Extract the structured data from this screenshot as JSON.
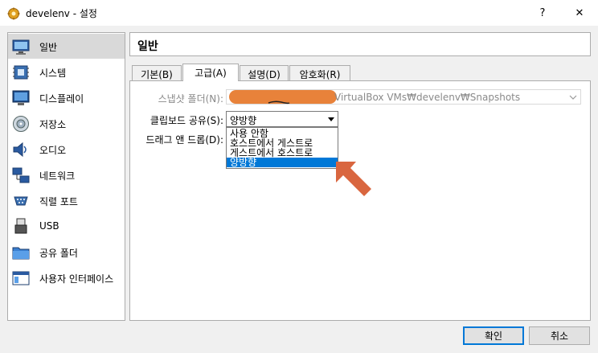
{
  "window": {
    "title": "develenv - 설정",
    "help_glyph": "?",
    "close_glyph": "✕"
  },
  "sidebar": {
    "items": [
      {
        "label": "일반",
        "icon": "general-monitor-icon"
      },
      {
        "label": "시스템",
        "icon": "system-chip-icon"
      },
      {
        "label": "디스플레이",
        "icon": "display-monitor-icon"
      },
      {
        "label": "저장소",
        "icon": "storage-disk-icon"
      },
      {
        "label": "오디오",
        "icon": "audio-speaker-icon"
      },
      {
        "label": "네트워크",
        "icon": "network-icon"
      },
      {
        "label": "직렬 포트",
        "icon": "serial-port-icon"
      },
      {
        "label": "USB",
        "icon": "usb-icon"
      },
      {
        "label": "공유 폴더",
        "icon": "shared-folder-icon"
      },
      {
        "label": "사용자 인터페이스",
        "icon": "user-interface-icon"
      }
    ]
  },
  "page": {
    "title": "일반"
  },
  "tabs": [
    {
      "label": "기본(B)"
    },
    {
      "label": "고급(A)"
    },
    {
      "label": "설명(D)"
    },
    {
      "label": "암호화(R)"
    }
  ],
  "advanced": {
    "snapshot_label": "스냅샷 폴더(N):",
    "snapshot_path_visible": "VirtualBox VMs₩develenv₩Snapshots",
    "clipboard_label": "클립보드 공유(S):",
    "clipboard_value": "양방향",
    "clipboard_options": [
      "사용 안함",
      "호스트에서 게스트로",
      "게스트에서 호스트로",
      "양방향"
    ],
    "dragdrop_label": "드래그 앤 드롭(D):"
  },
  "buttons": {
    "ok": "확인",
    "cancel": "취소"
  },
  "colors": {
    "accent": "#0078d7",
    "annotation_arrow": "#d9663f",
    "redaction": "#e8823a"
  }
}
